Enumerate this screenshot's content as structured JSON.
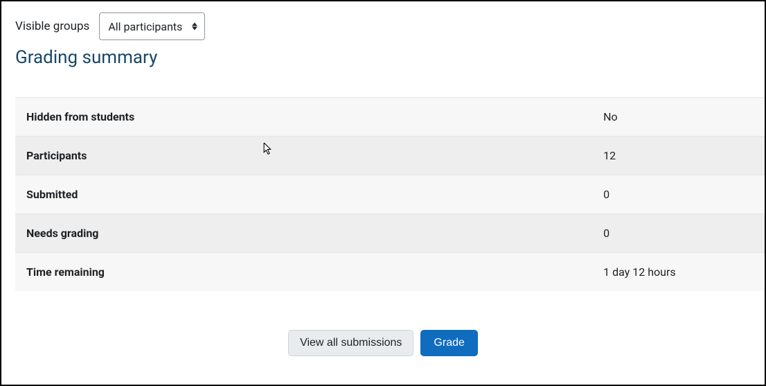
{
  "top": {
    "label": "Visible groups",
    "selected": "All participants"
  },
  "heading": "Grading summary",
  "rows": [
    {
      "label": "Hidden from students",
      "value": "No"
    },
    {
      "label": "Participants",
      "value": "12"
    },
    {
      "label": "Submitted",
      "value": "0"
    },
    {
      "label": "Needs grading",
      "value": "0"
    },
    {
      "label": "Time remaining",
      "value": "1 day 12 hours"
    }
  ],
  "actions": {
    "view_all": "View all submissions",
    "grade": "Grade"
  }
}
